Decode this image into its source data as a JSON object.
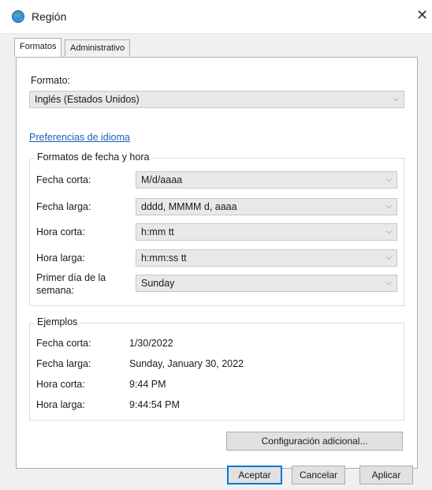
{
  "window": {
    "title": "Región",
    "close_glyph": "✕"
  },
  "tabs": [
    "Formatos",
    "Administrativo"
  ],
  "format": {
    "label": "Formato:",
    "value": "Inglés (Estados Unidos)"
  },
  "language_link": "Preferencias de idioma",
  "date_time_formats": {
    "title": "Formatos de fecha y hora",
    "rows": [
      {
        "label": "Fecha corta:",
        "value": "M/d/aaaa"
      },
      {
        "label": "Fecha larga:",
        "value": "dddd, MMMM d, aaaa"
      },
      {
        "label": "Hora corta:",
        "value": "h:mm tt"
      },
      {
        "label": "Hora larga:",
        "value": "h:mm:ss tt"
      },
      {
        "label": "Primer día de la semana:",
        "value": "Sunday"
      }
    ]
  },
  "examples": {
    "title": "Ejemplos",
    "rows": [
      {
        "label": "Fecha corta:",
        "value": "1/30/2022"
      },
      {
        "label": "Fecha larga:",
        "value": "Sunday, January 30, 2022"
      },
      {
        "label": "Hora corta:",
        "value": "9:44 PM"
      },
      {
        "label": "Hora larga:",
        "value": "9:44:54 PM"
      }
    ]
  },
  "buttons": {
    "additional": "Configuración adicional...",
    "accept": "Aceptar",
    "cancel": "Cancelar",
    "apply": "Aplicar"
  },
  "icons": {
    "window": "globe-icon",
    "dropdown": "chevron-down-icon",
    "close": "close-icon"
  }
}
